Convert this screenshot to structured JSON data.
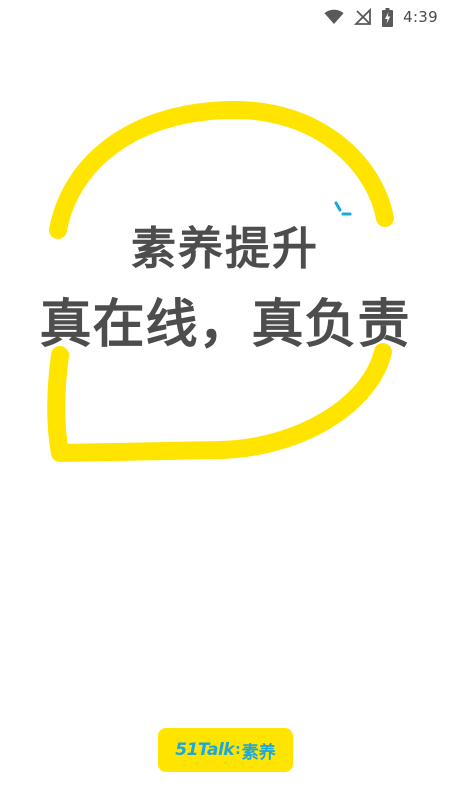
{
  "status_bar": {
    "time": "4:39",
    "icons": [
      "wifi-icon",
      "signal-off-icon",
      "battery-charging-icon"
    ]
  },
  "splash": {
    "line1": "素养提升",
    "line2": "真在线，真负责"
  },
  "brand": {
    "name_en": "51Talk",
    "separator": ":",
    "name_cn": "素养"
  },
  "colors": {
    "accent_yellow": "#ffe400",
    "headline_gray": "#4d4d4d",
    "brand_blue": "#1aa8e0",
    "background": "#ffffff"
  }
}
